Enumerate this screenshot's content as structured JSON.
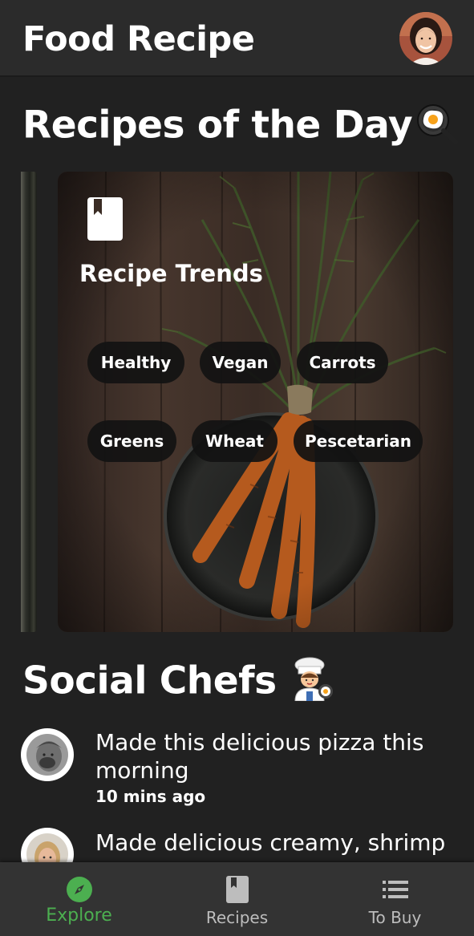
{
  "app": {
    "title": "Food Recipe"
  },
  "recipes_of_the_day": {
    "title": "Recipes of the Day",
    "emoji": "🍳",
    "card": {
      "title": "Recipe Trends",
      "icon": "book-icon",
      "tags": [
        "Healthy",
        "Vegan",
        "Carrots",
        "Greens",
        "Wheat",
        "Pescetarian"
      ]
    }
  },
  "social_chefs": {
    "title": "Social Chefs",
    "emoji": "👩‍🍳",
    "posts": [
      {
        "text": "Made this delicious pizza this morning",
        "time": "10 mins ago"
      },
      {
        "text": "Made delicious creamy, shrimp",
        "time": ""
      }
    ]
  },
  "bottom_nav": {
    "items": [
      {
        "label": "Explore",
        "icon": "compass-icon",
        "active": true
      },
      {
        "label": "Recipes",
        "icon": "book-icon",
        "active": false
      },
      {
        "label": "To Buy",
        "icon": "list-icon",
        "active": false
      }
    ]
  },
  "colors": {
    "background": "#212121",
    "appbar": "#2b2b2b",
    "nav": "#333333",
    "accent": "#4caf50",
    "chip": "#121212"
  }
}
